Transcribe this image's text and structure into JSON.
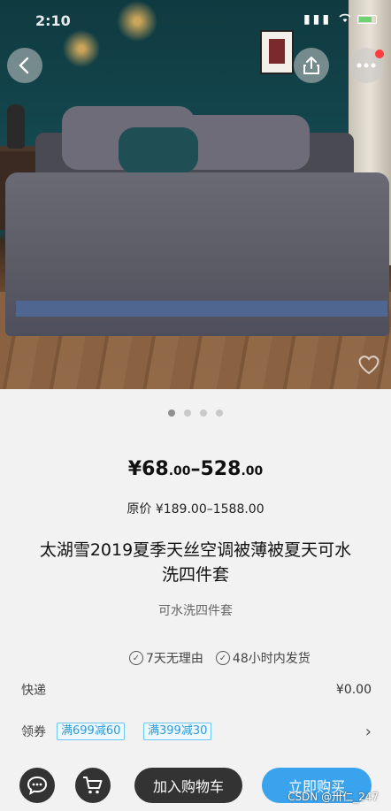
{
  "status_bar": {
    "time": "2:10"
  },
  "gallery": {
    "total": 4,
    "active_index": 0
  },
  "product": {
    "price_currency": "¥",
    "price_low_int": "68",
    "price_low_dec": ".00",
    "price_sep": "–",
    "price_high_int": "528",
    "price_high_dec": ".00",
    "original_label": "原价",
    "original_price": "¥189.00–1588.00",
    "title": "太湖雪2019夏季天丝空调被薄被夏天可水洗四件套",
    "subtitle": "可水洗四件套"
  },
  "guarantees": [
    "7天无理由",
    "48小时内发货"
  ],
  "shipping": {
    "label": "快递",
    "value": "¥0.00"
  },
  "coupons": {
    "label": "领券",
    "items": [
      "满699减60",
      "满399减30"
    ]
  },
  "bottom_bar": {
    "add_to_cart": "加入购物车",
    "buy_now": "立即购买"
  },
  "watermark": "CSDN @卅仁_247",
  "colors": {
    "accent": "#3aa3ee",
    "coupon_text": "#2e9ad6",
    "dark_button": "#333333"
  }
}
